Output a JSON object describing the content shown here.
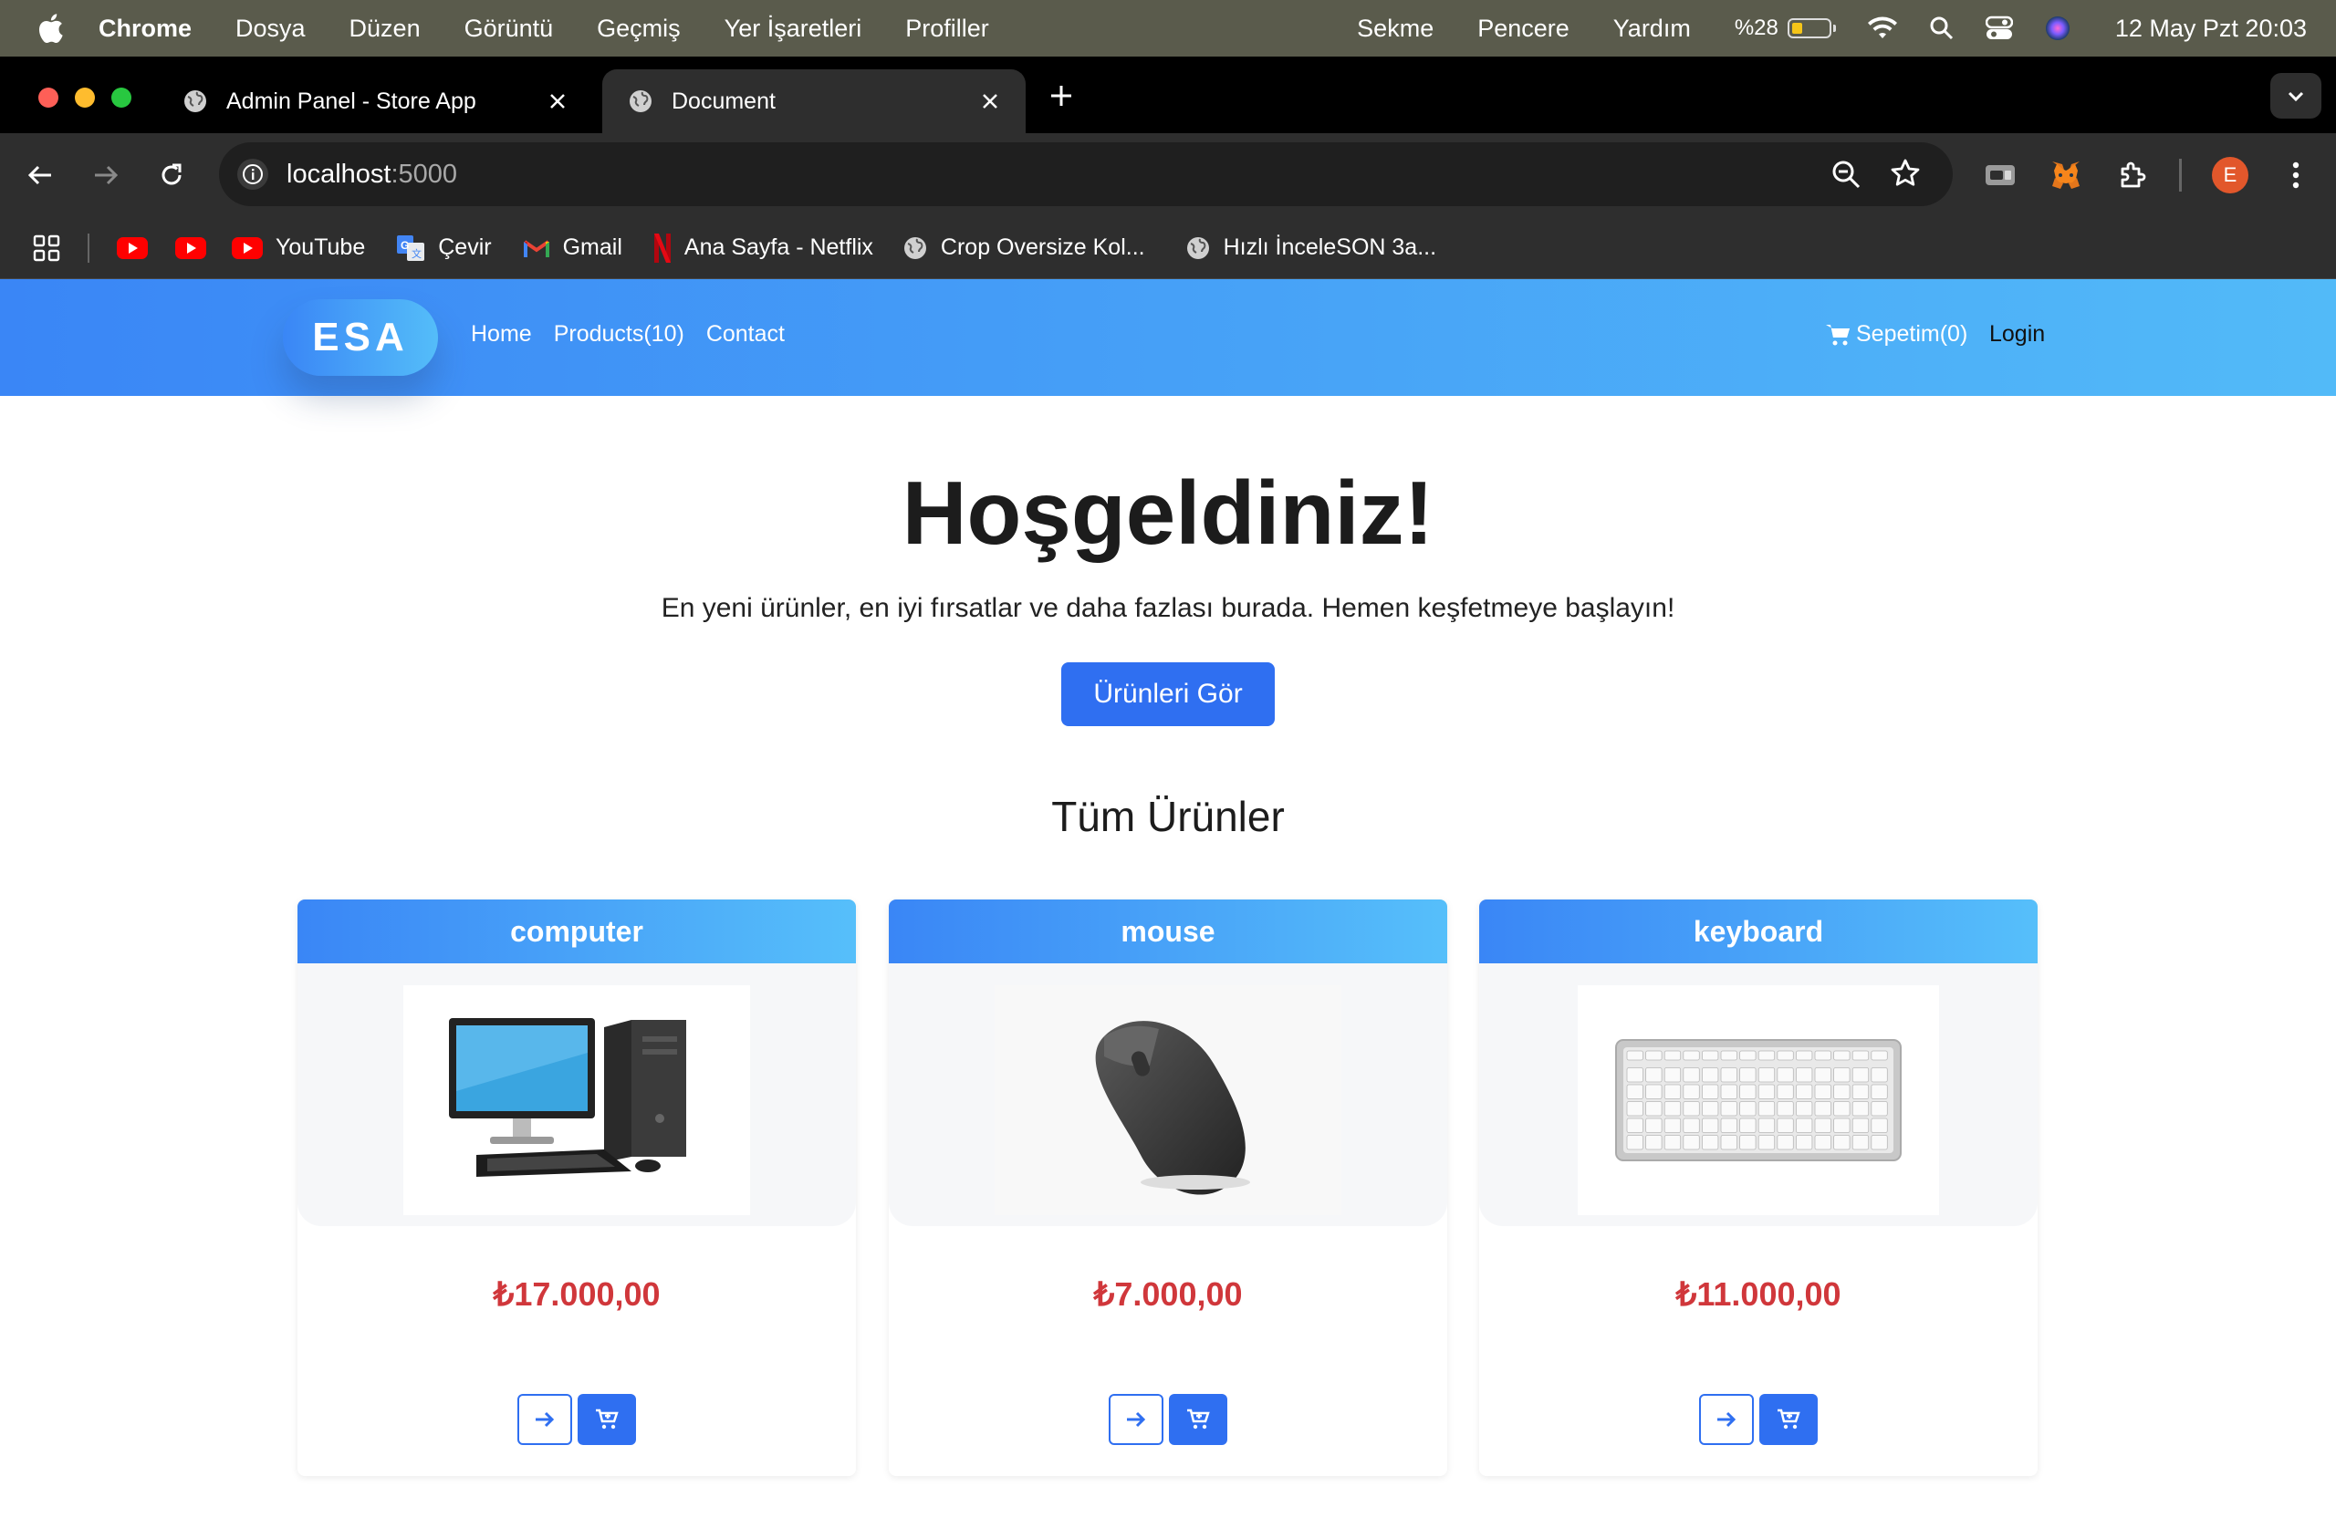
{
  "menubar": {
    "app": "Chrome",
    "items": [
      "Dosya",
      "Düzen",
      "Görüntü",
      "Geçmiş",
      "Yer İşaretleri",
      "Profiller"
    ],
    "right_items": [
      "Sekme",
      "Pencere",
      "Yardım"
    ],
    "battery_percent": "%28",
    "battery_level": 0.28,
    "datetime": "12 May Pzt  20:03"
  },
  "browser": {
    "tabs": [
      {
        "title": "Admin Panel - Store App",
        "active": false
      },
      {
        "title": "Document",
        "active": true
      }
    ],
    "url_host": "localhost",
    "url_port": ":5000",
    "profile_initial": "E",
    "bookmarks": [
      {
        "label": "",
        "icon": "youtube-icon"
      },
      {
        "label": "",
        "icon": "youtube-icon"
      },
      {
        "label": "YouTube",
        "icon": "youtube-icon"
      },
      {
        "label": "Çevir",
        "icon": "translate-icon"
      },
      {
        "label": "Gmail",
        "icon": "gmail-icon"
      },
      {
        "label": "Ana Sayfa - Netflix",
        "icon": "netflix-icon"
      },
      {
        "label": "Crop Oversize Kol...",
        "icon": "globe-icon"
      },
      {
        "label": "Hızlı İnceleSON 3a...",
        "icon": "globe-icon"
      }
    ]
  },
  "site": {
    "logo": "ESA",
    "nav": [
      "Home",
      "Products(10)",
      "Contact"
    ],
    "cart": "Sepetim(0)",
    "login": "Login",
    "hero_title": "Hoşgeldiniz!",
    "hero_subtitle": "En yeni ürünler, en iyi fırsatlar ve daha fazlası burada. Hemen keşfetmeye başlayın!",
    "hero_button": "Ürünleri Gör",
    "section_title": "Tüm Ürünler",
    "accent_color": "#2f6ff1",
    "price_color": "#d0373b",
    "products": [
      {
        "name": "computer",
        "price": "₺17.000,00",
        "image": "computer-image"
      },
      {
        "name": "mouse",
        "price": "₺7.000,00",
        "image": "mouse-image"
      },
      {
        "name": "keyboard",
        "price": "₺11.000,00",
        "image": "keyboard-image"
      }
    ]
  }
}
